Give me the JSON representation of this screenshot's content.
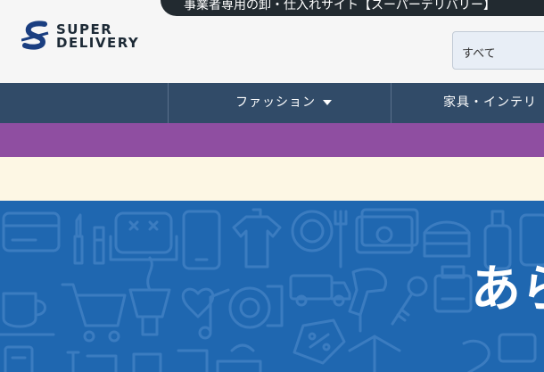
{
  "header": {
    "tagline": "事業者専用の卸・仕入れサイト【スーパーデリバリー】",
    "logo": {
      "line1": "SUPER",
      "line2": "DELIVERY"
    },
    "search_select": "すべて"
  },
  "nav": {
    "items": [
      {
        "label": "ファッション"
      },
      {
        "label": "家具・インテリ"
      }
    ]
  },
  "hero": {
    "heading": "あら"
  },
  "colors": {
    "nav_bg": "#314b68",
    "purple_bar": "#8f4ea1",
    "cream_bar": "#fdf7e4",
    "hero_bg": "#1f67b0"
  }
}
